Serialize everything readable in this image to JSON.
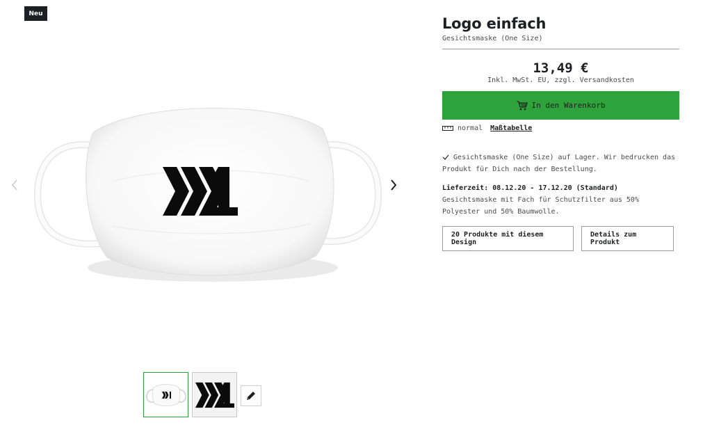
{
  "badge": {
    "label": "Neu"
  },
  "gallery": {
    "prev_icon": "chevron-left-icon",
    "next_icon": "chevron-right-icon",
    "edit_icon": "pencil-icon"
  },
  "product": {
    "title": "Logo einfach",
    "subtitle": "Gesichtsmaske (One Size)",
    "price": "13,49 €",
    "price_note": "Inkl. MwSt. EU, zzgl. Versandkosten"
  },
  "cart": {
    "label": "In den Warenkorb",
    "icon": "cart-icon",
    "color": "#2fa33b"
  },
  "size": {
    "icon": "ruler-icon",
    "fit_label": "normal",
    "size_chart_link": "Maßtabelle"
  },
  "stock": {
    "icon": "checkmark-icon",
    "text": "Gesichtsmaske (One Size) auf Lager. Wir bedrucken das Produkt für Dich nach der Bestellung."
  },
  "delivery": {
    "label": "Lieferzeit: 08.12.20 - 17.12.20 (Standard)",
    "description": "Gesichtsmaske mit Fach für Schutzfilter aus 50% Polyester und 50% Baumwolle."
  },
  "actions": {
    "design_products": "20 Produkte mit diesem Design",
    "product_details": "Details zum Produkt"
  }
}
